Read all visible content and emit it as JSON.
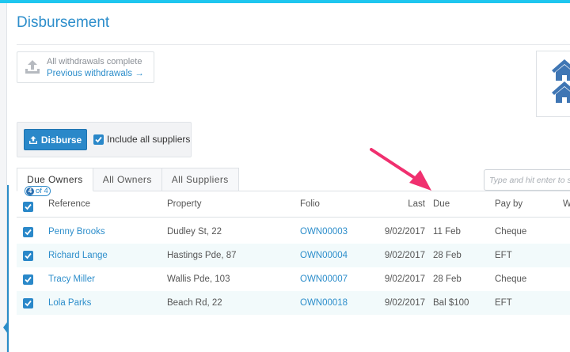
{
  "page": {
    "title": "Disbursement"
  },
  "withdrawals": {
    "status": "All withdrawals complete",
    "link_label": "Previous withdrawals →"
  },
  "actions": {
    "disburse_label": "Disburse",
    "include_suppliers_label": "Include all suppliers",
    "include_suppliers_checked": true
  },
  "tabs": [
    {
      "label": "Due Owners",
      "active": true
    },
    {
      "label": "All Owners",
      "active": false
    },
    {
      "label": "All Suppliers",
      "active": false
    }
  ],
  "badge": {
    "current": "4",
    "text": "of 4"
  },
  "search": {
    "placeholder": "Type and hit enter to search"
  },
  "table": {
    "columns": {
      "reference": "Reference",
      "property": "Property",
      "folio": "Folio",
      "last": "Last",
      "due": "Due",
      "pay_by": "Pay by",
      "extra": "W"
    },
    "rows": [
      {
        "reference": "Penny Brooks",
        "property": "Dudley St, 22",
        "folio": "OWN00003",
        "last": "9/02/2017",
        "due": "11 Feb",
        "pay_by": "Cheque"
      },
      {
        "reference": "Richard Lange",
        "property": "Hastings Pde, 87",
        "folio": "OWN00004",
        "last": "9/02/2017",
        "due": "28 Feb",
        "pay_by": "EFT"
      },
      {
        "reference": "Tracy Miller",
        "property": "Wallis Pde, 103",
        "folio": "OWN00007",
        "last": "9/02/2017",
        "due": "28 Feb",
        "pay_by": "Cheque"
      },
      {
        "reference": "Lola Parks",
        "property": "Beach Rd, 22",
        "folio": "OWN00018",
        "last": "9/02/2017",
        "due": "Bal $100",
        "pay_by": "EFT"
      }
    ]
  },
  "colors": {
    "accent": "#2d8ecb",
    "top_bar": "#1ec6ef",
    "annotation_arrow": "#f0306f",
    "stripe": "#f2fafb"
  },
  "icons": {
    "withdraw": "upload-tray-icon",
    "disburse": "upload-icon",
    "right_card": "house-icon"
  }
}
